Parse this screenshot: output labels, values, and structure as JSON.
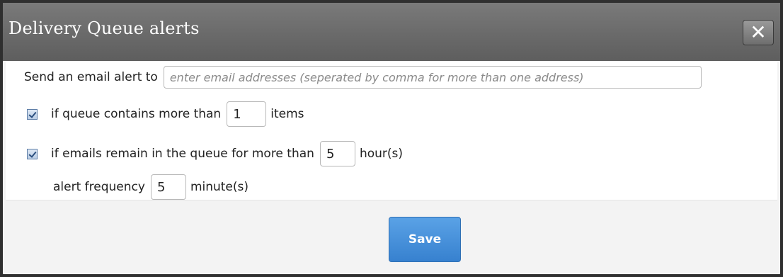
{
  "dialog": {
    "title": "Delivery Queue alerts",
    "close_label": "✕"
  },
  "email_alert": {
    "label": "Send an email alert to",
    "placeholder": "enter email addresses (seperated by comma for more than one address)",
    "value": ""
  },
  "queue_size_rule": {
    "checked": true,
    "label_before": "if queue contains more than",
    "value": "1",
    "label_after": "items"
  },
  "queue_age_rule": {
    "checked": true,
    "label_before": "if emails remain in the queue for more than",
    "value": "5",
    "label_after": "hour(s)"
  },
  "alert_frequency": {
    "label_before": "alert frequency",
    "value": "5",
    "label_after": "minute(s)"
  },
  "footer": {
    "save_label": "Save"
  },
  "colors": {
    "titlebar": "#6a6a6a",
    "save_button": "#3781cf"
  }
}
